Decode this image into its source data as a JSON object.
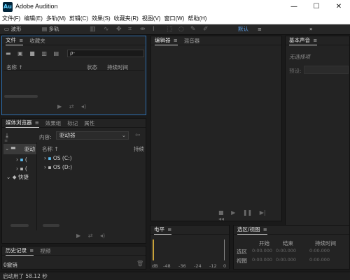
{
  "window": {
    "title": "Adobe Audition",
    "min": "—",
    "max": "☐",
    "close": "✕"
  },
  "menu": [
    "文件(F)",
    "编辑(E)",
    "多轨(M)",
    "剪辑(C)",
    "效果(S)",
    "收藏夹(R)",
    "视图(V)",
    "窗口(W)",
    "帮助(H)"
  ],
  "toolbar": {
    "waveform": "波形",
    "multitrack": "多轨",
    "workspace": "默认",
    "more": "»"
  },
  "files_panel": {
    "tabs": [
      "文件",
      "收藏夹"
    ],
    "search_placeholder": "ρ-",
    "columns": {
      "name": "名称 ↑",
      "status": "状态",
      "duration": "持续时间"
    }
  },
  "editor_panel": {
    "tabs": [
      "编辑器",
      "混音器"
    ]
  },
  "essential_sound": {
    "tab": "基本声音",
    "no_selection": "无选择项",
    "preset_label": "预设:"
  },
  "media_browser": {
    "tabs": [
      "媒体浏览器",
      "效果组",
      "标记",
      "属性"
    ],
    "content_label": "内容:",
    "content_value": "驱动器",
    "left_tree": [
      "驱动",
      "(",
      "(",
      "快捷"
    ],
    "columns": {
      "name": "名称 ↑",
      "duration": "持续"
    },
    "drives": [
      "OS (C:)",
      "OS (D:)"
    ]
  },
  "history_panel": {
    "tabs": [
      "历史记录",
      "视频"
    ],
    "undo_count": "0撤销"
  },
  "level_panel": {
    "tab": "电平",
    "scale": [
      "dB",
      "-48",
      "-36",
      "-24",
      "-12",
      "0"
    ]
  },
  "selection_view": {
    "tab": "选区/视图",
    "headers": [
      "开始",
      "结束",
      "持续时间"
    ],
    "rows": [
      {
        "label": "选区",
        "start": "0:00.000",
        "end": "0:00.000",
        "duration": "0:00.000"
      },
      {
        "label": "视图",
        "start": "0:00.000",
        "end": "0:00.000",
        "duration": "0:00.000"
      }
    ]
  },
  "status": {
    "text": "启动用了 58.12 秒"
  },
  "colors": {
    "accent_blue": "#2e6fb0",
    "bg": "#1a1a1a",
    "panel": "#232323"
  }
}
